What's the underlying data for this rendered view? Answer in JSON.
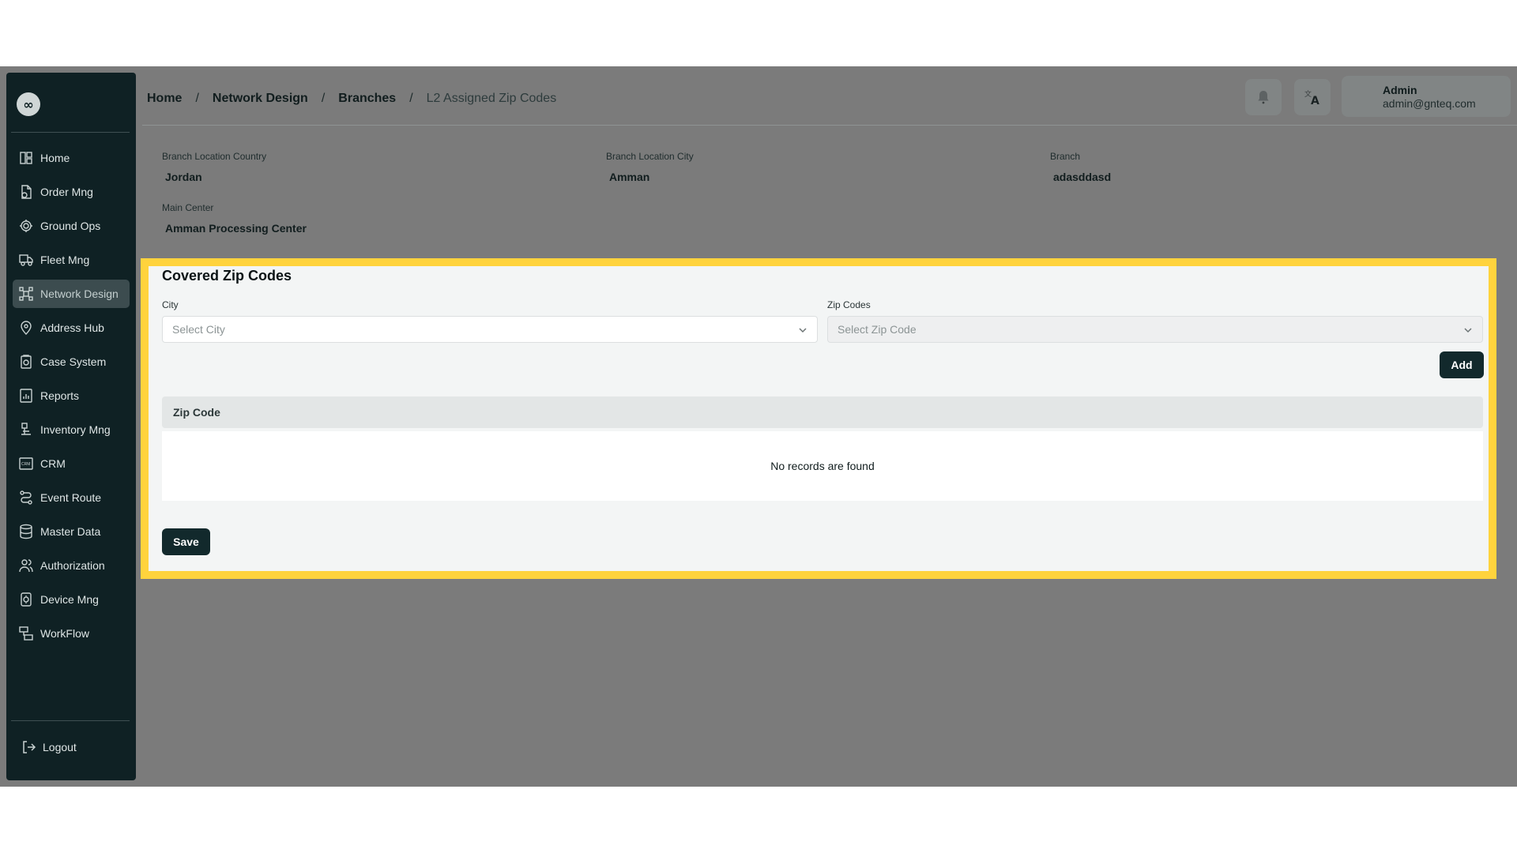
{
  "sidebar": {
    "logo": "∞",
    "items": [
      {
        "label": "Home",
        "icon": "dashboard-icon"
      },
      {
        "label": "Order Mng",
        "icon": "order-icon"
      },
      {
        "label": "Ground Ops",
        "icon": "ground-ops-icon"
      },
      {
        "label": "Fleet Mng",
        "icon": "truck-icon"
      },
      {
        "label": "Network Design",
        "icon": "network-icon",
        "active": true
      },
      {
        "label": "Address Hub",
        "icon": "location-icon"
      },
      {
        "label": "Case System",
        "icon": "case-icon"
      },
      {
        "label": "Reports",
        "icon": "reports-icon"
      },
      {
        "label": "Inventory Mng",
        "icon": "inventory-icon"
      },
      {
        "label": "CRM",
        "icon": "crm-icon"
      },
      {
        "label": "Event Route",
        "icon": "route-icon"
      },
      {
        "label": "Master Data",
        "icon": "database-icon"
      },
      {
        "label": "Authorization",
        "icon": "users-icon"
      },
      {
        "label": "Device Mng",
        "icon": "device-icon"
      },
      {
        "label": "WorkFlow",
        "icon": "workflow-icon"
      }
    ],
    "logout_label": "Logout"
  },
  "breadcrumb": {
    "items": [
      "Home",
      "Network Design",
      "Branches"
    ],
    "separator": "/",
    "current": "L2 Assigned Zip Codes"
  },
  "user": {
    "name": "Admin",
    "email": "admin@gnteq.com"
  },
  "details": {
    "country_label": "Branch Location Country",
    "country_value": "Jordan",
    "city_label": "Branch Location City",
    "city_value": "Amman",
    "branch_label": "Branch",
    "branch_value": "adasddasd",
    "center_label": "Main Center",
    "center_value": "Amman Processing Center"
  },
  "covered": {
    "title": "Covered Zip Codes",
    "city_label": "City",
    "city_placeholder": "Select City",
    "zip_label": "Zip Codes",
    "zip_placeholder": "Select Zip Code",
    "add_label": "Add",
    "table_header": "Zip Code",
    "empty_text": "No records are found",
    "save_label": "Save"
  },
  "colors": {
    "sidebar_bg": "#0f2124",
    "highlight": "#ffd33d",
    "button": "#12292c"
  }
}
